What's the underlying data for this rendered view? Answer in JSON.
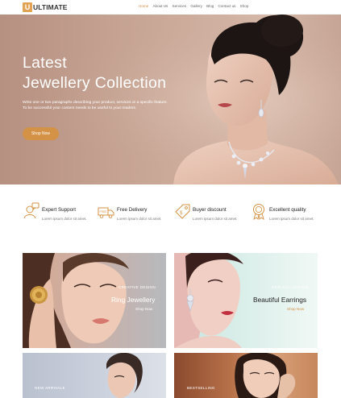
{
  "header": {
    "logo_letter": "U",
    "logo_text": "ULTIMATE",
    "nav": [
      "Home",
      "About Us",
      "Services",
      "Gallery",
      "Blog",
      "Contact us",
      "Shop"
    ],
    "active_nav": "Home"
  },
  "hero": {
    "title_line1": "Latest",
    "title_line2": "Jewellery Collection",
    "desc_line1": "Write one or two paragraphs describing your product, services or a specific feature.",
    "desc_line2": "To be successful your content needs to be useful to your readers.",
    "button": "Shop Now"
  },
  "features": [
    {
      "title": "Expert Support",
      "desc": "Lorem ipsum dolor sit amet.",
      "icon": "support-agent-icon"
    },
    {
      "title": "Free Delivery",
      "desc": "Lorem ipsum dolor sit amet.",
      "icon": "delivery-truck-icon"
    },
    {
      "title": "Buyer discount",
      "desc": "Lorem ipsum dolor sit amet.",
      "icon": "discount-tag-icon"
    },
    {
      "title": "Excellent quality",
      "desc": "Lorem ipsum dolor sit amet.",
      "icon": "quality-badge-icon"
    }
  ],
  "cards": [
    {
      "label": "CREATIVE DESIGN",
      "title": "Ring Jewellery",
      "link": "Shop Now"
    },
    {
      "label": "NEW COLLECTION",
      "title": "Beautiful Earrings",
      "link": "Shop Now"
    },
    {
      "label": "NEW ARRIVALS",
      "title": "",
      "link": ""
    },
    {
      "label": "BESTSELLING",
      "title": "",
      "link": ""
    }
  ],
  "colors": {
    "accent": "#d49246",
    "nav_active": "#d8914a",
    "icon_stroke": "#d49246"
  }
}
